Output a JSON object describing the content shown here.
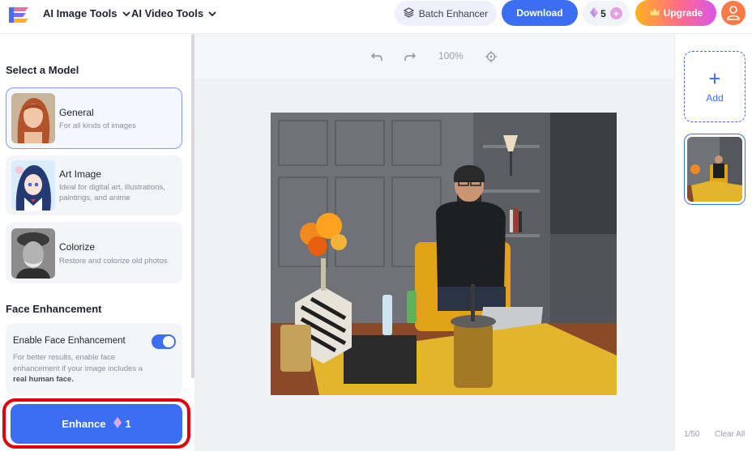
{
  "header": {
    "logo_icon": "app-logo-icon",
    "nav": [
      {
        "label": "AI Image Tools",
        "icon": "chevron-down-icon"
      },
      {
        "label": "AI Video Tools",
        "icon": "chevron-down-icon"
      }
    ],
    "batch_label": "Batch Enhancer",
    "download_label": "Download",
    "credits_count": "5",
    "credits_plus": "+",
    "upgrade_label": "Upgrade",
    "accent_color": "#3b6ef3"
  },
  "sidebar": {
    "model_section_title": "Select a Model",
    "models": [
      {
        "name": "General",
        "desc": "For all kinds of images",
        "selected": true
      },
      {
        "name": "Art Image",
        "desc": "Ideal for digital art, illustrations, paintings, and anime",
        "selected": false
      },
      {
        "name": "Colorize",
        "desc": "Restore and colorize old photos",
        "selected": false
      }
    ],
    "face_section_title": "Face Enhancement",
    "face_toggle_label": "Enable Face Enhancement",
    "face_toggle_on": true,
    "face_note_prefix": "For better results, enable face enhancement if your image includes a ",
    "face_note_bold": "real human face.",
    "enhance_label": "Enhance",
    "enhance_cost": "1"
  },
  "canvas": {
    "zoom": "100%",
    "tools": [
      "undo-icon",
      "redo-icon",
      "locate-icon"
    ]
  },
  "right_panel": {
    "add_plus": "+",
    "add_label": "Add",
    "count": "1/50",
    "clear_label": "Clear All"
  }
}
